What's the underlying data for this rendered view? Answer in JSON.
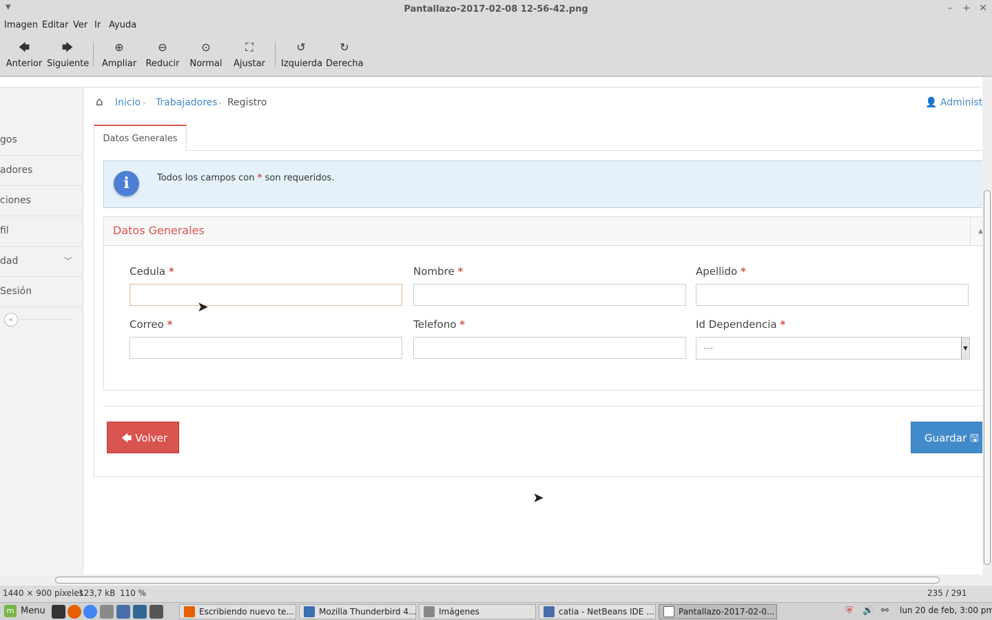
{
  "window": {
    "title": "Pantallazo-2017-02-08 12-56-42.png",
    "controls": {
      "minimize": "–",
      "maximize": "+",
      "close": "✕"
    }
  },
  "menubar": [
    "Imagen",
    "Editar",
    "Ver",
    "Ir",
    "Ayuda"
  ],
  "toolbar": {
    "prev": "Anterior",
    "next": "Siguiente",
    "zoom_in": "Ampliar",
    "zoom_out": "Reducir",
    "normal": "Normal",
    "fit": "Ajustar",
    "rotate_left": "Izquierda",
    "rotate_right": "Derecha"
  },
  "page": {
    "sidebar": {
      "items": [
        "gos",
        "adores",
        "ciones",
        "fil",
        "dad",
        "Sesión"
      ]
    },
    "breadcrumb": {
      "home": "Inicio",
      "section": "Trabajadores",
      "current": "Registro",
      "separator": "›"
    },
    "user": "Administr",
    "tab": "Datos Generales",
    "alert": {
      "before": "Todos los campos con",
      "required_mark": "*",
      "after": "son requeridos."
    },
    "panel_title": "Datos Generales",
    "fields": {
      "cedula": "Cedula",
      "nombre": "Nombre",
      "apellido": "Apellido",
      "correo": "Correo",
      "telefono": "Telefono",
      "dependencia": "Id Dependencia",
      "dependencia_value": "---",
      "required_mark": "*"
    },
    "buttons": {
      "back": "Volver",
      "save": "Guardar"
    }
  },
  "statusbar": {
    "dimensions": "1440 × 900 píxeles",
    "size": "123,7 kB",
    "zoom": "110 %",
    "position": "235 / 291"
  },
  "taskbar": {
    "menu": "Menu",
    "tasks": [
      "Escribiendo nuevo te...",
      "Mozilla Thunderbird 4...",
      "Imágenes",
      "catia - NetBeans IDE ...",
      "Pantallazo-2017-02-0..."
    ],
    "clock": "lun 20 de feb,  3:00 pm"
  },
  "colors": {
    "accent_red": "#d9534f",
    "link_blue": "#428bca",
    "alert_bg": "#e4f1fb",
    "info_icon": "#4d7fd4"
  }
}
